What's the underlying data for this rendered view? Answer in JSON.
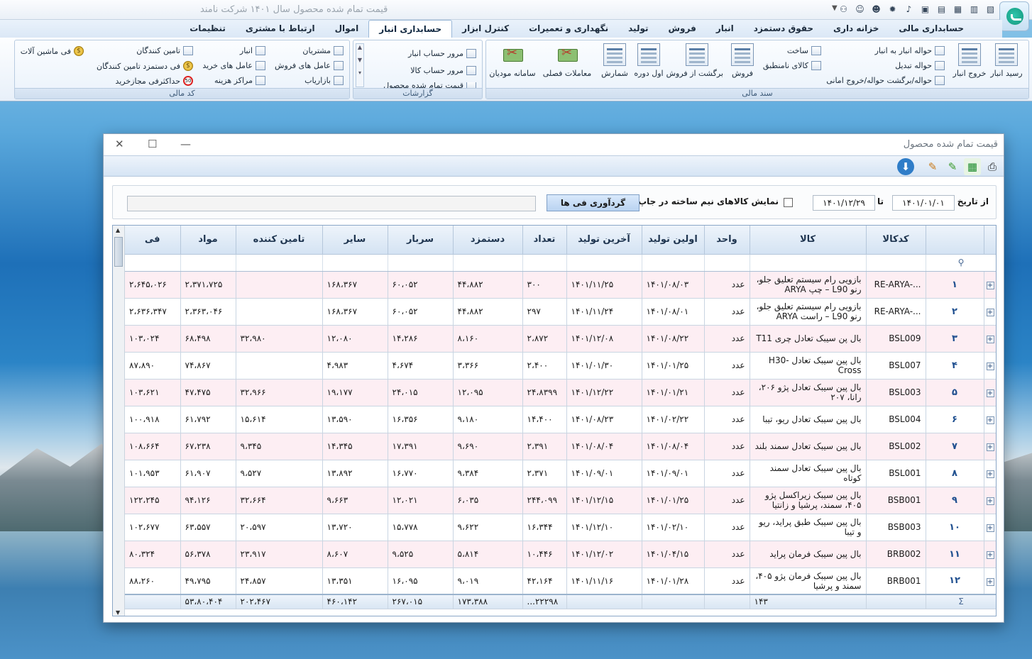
{
  "app": {
    "title": "قیمت تمام شده محصول    سال ۱۴۰۱ شرکت نامند"
  },
  "tabs": [
    "حسابداری مالی",
    "خزانه داری",
    "حقوق دستمزد",
    "انبار",
    "فروش",
    "تولید",
    "نگهداری و تعمیرات",
    "کنترل ابزار",
    "حسابداری انبار",
    "اموال",
    "ارتباط با مشتری",
    "تنظیمات"
  ],
  "active_tab": "حسابداری انبار",
  "ribbon": {
    "g1": {
      "label": "سند مالی",
      "b_receive": "رسید انبار",
      "b_exit": "خروج انبار",
      "b_transfer": "حواله انبار به انبار",
      "b_convert": "حواله تبدیل",
      "b_return": "حواله/برگشت حواله/خروج امانی",
      "b_build": "ساخت",
      "b_nonconf": "کالای نامنطبق",
      "b_sale": "فروش",
      "b_saleret": "برگشت از فروش",
      "b_opening": "اول دوره",
      "b_count": "شمارش",
      "b_season": "معاملات فصلی",
      "b_tax": "سامانه مودیان"
    },
    "g2": {
      "label": "گزارشات",
      "r1": "مرور حساب انبار",
      "r2": "مرور حساب کالا",
      "r3": "قیمت تمام شده محصول"
    },
    "g3": {
      "label": "کد مالی",
      "c1": "مشتریان",
      "c2": "عامل های فروش",
      "c3": "بازاریاب",
      "c4": "انبار",
      "c5": "عامل های خرید",
      "c6": "مراکز هزینه",
      "c7": "تامین کنندگان",
      "c8": "فی دستمزد تامین کنندگان",
      "c9": "حداکثرفی مجازخرید",
      "c10": "فی ماشین آلات"
    }
  },
  "window": {
    "title": "قیمت تمام شده محصول"
  },
  "filter": {
    "from_label": "از تاریخ",
    "from": "۱۴۰۱/۰۱/۰۱",
    "to_label": "تا",
    "to": "۱۴۰۱/۱۲/۲۹",
    "semi_label": "نمایش کالاهای نیم ساخته در جاپ",
    "collect_btn": "گردآوری فی ها"
  },
  "columns": [
    "کدکالا",
    "کالا",
    "واحد",
    "اولین تولید",
    "آخرین تولید",
    "تعداد",
    "دستمزد",
    "سربار",
    "سایر",
    "تامین کننده",
    "مواد",
    "فی"
  ],
  "rows": [
    {
      "idx": "۱",
      "code": "RE-ARYA-...",
      "name": "بازویی رام سیستم تعلیق جلو، رنو L90 – چپ ARYA",
      "unit": "عدد",
      "first": "۱۴۰۱/۰۸/۰۳",
      "last": "۱۴۰۱/۱۱/۲۵",
      "qty": "۳۰۰",
      "wage": "۴۴،۸۸۲",
      "over": "۶۰،۰۵۲",
      "other": "۱۶۸،۳۶۷",
      "supp": "",
      "mat": "۲،۳۷۱،۷۲۵",
      "fee": "۲،۶۴۵،۰۲۶"
    },
    {
      "idx": "۲",
      "code": "RE-ARYA-...",
      "name": "بازویی رام سیستم تعلیق جلو، رنو L90 – راست ARYA",
      "unit": "عدد",
      "first": "۱۴۰۱/۰۸/۰۱",
      "last": "۱۴۰۱/۱۱/۲۴",
      "qty": "۲۹۷",
      "wage": "۴۴،۸۸۲",
      "over": "۶۰،۰۵۲",
      "other": "۱۶۸،۳۶۷",
      "supp": "",
      "mat": "۲،۳۶۳،۰۴۶",
      "fee": "۲،۶۳۶،۳۴۷"
    },
    {
      "idx": "۳",
      "code": "BSL009",
      "name": "بال پن سیبک تعادل چری T11",
      "unit": "عدد",
      "first": "۱۴۰۱/۰۸/۲۲",
      "last": "۱۴۰۱/۱۲/۰۸",
      "qty": "۲،۸۷۲",
      "wage": "۸،۱۶۰",
      "over": "۱۴،۲۸۶",
      "other": "۱۲،۰۸۰",
      "supp": "۳۲،۹۸۰",
      "mat": "۶۸،۴۹۸",
      "fee": "۱۰۳،۰۲۴"
    },
    {
      "idx": "۴",
      "code": "BSL007",
      "name": "بال پین سیبک تعادل H30-Cross",
      "unit": "عدد",
      "first": "۱۴۰۱/۰۱/۲۵",
      "last": "۱۴۰۱/۰۱/۳۰",
      "qty": "۲،۴۰۰",
      "wage": "۳،۳۶۶",
      "over": "۴،۶۷۴",
      "other": "۴،۹۸۳",
      "supp": "",
      "mat": "۷۴،۸۶۷",
      "fee": "۸۷،۸۹۰"
    },
    {
      "idx": "۵",
      "code": "BSL003",
      "name": "بال پین سیبک تعادل پژو ۲۰۶، رانا، ۲۰۷",
      "unit": "عدد",
      "first": "۱۴۰۱/۰۱/۲۱",
      "last": "۱۴۰۱/۱۲/۲۲",
      "qty": "۲۴،۸۳۹۹",
      "wage": "۱۲،۰۹۵",
      "over": "۲۴،۰۱۵",
      "other": "۱۹،۱۷۷",
      "supp": "۳۲،۹۶۶",
      "mat": "۴۷،۴۷۵",
      "fee": "۱۰۳،۶۲۱"
    },
    {
      "idx": "۶",
      "code": "BSL004",
      "name": "بال پین سیبک تعادل ریو، تیبا",
      "unit": "عدد",
      "first": "۱۴۰۱/۰۲/۲۲",
      "last": "۱۴۰۱/۰۸/۲۳",
      "qty": "۱۴،۴۰۰",
      "wage": "۹،۱۸۰",
      "over": "۱۶،۳۵۶",
      "other": "۱۳،۵۹۰",
      "supp": "۱۵،۶۱۴",
      "mat": "۶۱،۷۹۲",
      "fee": "۱۰۰،۹۱۸"
    },
    {
      "idx": "۷",
      "code": "BSL002",
      "name": "بال پین سیبک تعادل سمند بلند",
      "unit": "عدد",
      "first": "۱۴۰۱/۰۸/۰۴",
      "last": "۱۴۰۱/۰۸/۰۴",
      "qty": "۲،۳۹۱",
      "wage": "۹،۶۹۰",
      "over": "۱۷،۳۹۱",
      "other": "۱۴،۳۴۵",
      "supp": "۹،۳۴۵",
      "mat": "۶۷،۲۳۸",
      "fee": "۱۰۸،۶۶۴"
    },
    {
      "idx": "۸",
      "code": "BSL001",
      "name": "بال پین سیبک تعادل سمند کوتاه",
      "unit": "عدد",
      "first": "۱۴۰۱/۰۹/۰۱",
      "last": "۱۴۰۱/۰۹/۰۱",
      "qty": "۲،۳۷۱",
      "wage": "۹،۳۸۴",
      "over": "۱۶،۷۷۰",
      "other": "۱۳،۸۹۲",
      "supp": "۹،۵۲۷",
      "mat": "۶۱،۹۰۷",
      "fee": "۱۰۱،۹۵۳"
    },
    {
      "idx": "۹",
      "code": "BSB001",
      "name": "بال پین سیبک زیراکسل پژو ۴۰۵، سمند، پرشیا و زانتیا",
      "unit": "عدد",
      "first": "۱۴۰۱/۰۱/۲۵",
      "last": "۱۴۰۱/۱۲/۱۵",
      "qty": "۲۴۴،۰۹۹",
      "wage": "۶،۰۳۵",
      "over": "۱۲،۰۲۱",
      "other": "۹،۶۶۳",
      "supp": "۳۲،۶۶۴",
      "mat": "۹۴،۱۲۶",
      "fee": "۱۲۲،۲۴۵"
    },
    {
      "idx": "۱۰",
      "code": "BSB003",
      "name": "بال پین سیبک طبق پراید، ریو و تیبا",
      "unit": "عدد",
      "first": "۱۴۰۱/۰۲/۱۰",
      "last": "۱۴۰۱/۱۲/۱۰",
      "qty": "۱۶،۳۴۴",
      "wage": "۹،۶۲۲",
      "over": "۱۵،۷۷۸",
      "other": "۱۳،۷۲۰",
      "supp": "۲۰،۵۹۷",
      "mat": "۶۳،۵۵۷",
      "fee": "۱۰۲،۶۷۷"
    },
    {
      "idx": "۱۱",
      "code": "BRB002",
      "name": "بال پین سیبک فرمان پراید",
      "unit": "عدد",
      "first": "۱۴۰۱/۰۴/۱۵",
      "last": "۱۴۰۱/۱۲/۰۲",
      "qty": "۱۰،۴۴۶",
      "wage": "۵،۸۱۴",
      "over": "۹،۵۲۵",
      "other": "۸،۶۰۷",
      "supp": "۲۳،۹۱۷",
      "mat": "۵۶،۳۷۸",
      "fee": "۸۰،۳۲۴"
    },
    {
      "idx": "۱۲",
      "code": "BRB001",
      "name": "بال پین سیبک فرمان پژو ۴۰۵، سمند و پرشیا",
      "unit": "عدد",
      "first": "۱۴۰۱/۰۱/۲۸",
      "last": "۱۴۰۱/۱۱/۱۶",
      "qty": "۴۲،۱۶۴",
      "wage": "۹،۰۱۹",
      "over": "۱۶،۰۹۵",
      "other": "۱۳،۳۵۱",
      "supp": "۲۴،۸۵۷",
      "mat": "۴۹،۷۹۵",
      "fee": "۸۸،۲۶۰"
    }
  ],
  "summary": {
    "count": "۱۴۳",
    "qty": "...۲۲۲۹۸",
    "wage": "۱۷۳،۳۸۸",
    "over": "۲۶۷،۰۱۵",
    "other": "۴۶۰،۱۴۲",
    "supp": "۲۰۲،۴۶۷",
    "mat": "۵۳،۸۰،۴۰۴",
    "fee": ""
  }
}
